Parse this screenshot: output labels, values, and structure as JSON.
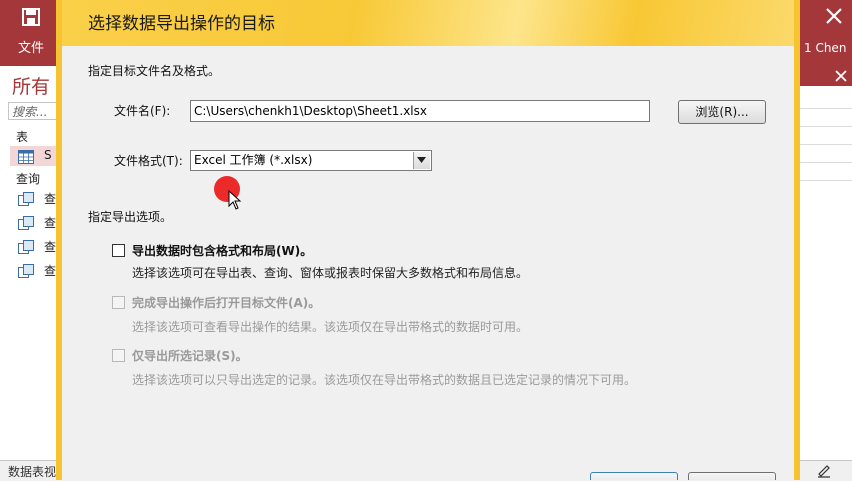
{
  "background": {
    "file_tab": "文件",
    "user_name": "1 Chen",
    "nav_title": "所有",
    "search_placeholder": "搜索...",
    "categories": {
      "tables": "表",
      "queries": "查询"
    },
    "nav_items": [
      {
        "label": "S",
        "icon": "table-icon",
        "selected": true
      },
      {
        "label": "查",
        "icon": "query-icon"
      },
      {
        "label": "查",
        "icon": "query-icon"
      },
      {
        "label": "查",
        "icon": "query-icon"
      },
      {
        "label": "查",
        "icon": "query-icon"
      }
    ],
    "status_text": "数据表视",
    "accent_color": "#a4373a"
  },
  "dialog": {
    "title": "选择数据导出操作的目标",
    "header_color": "#f8c937",
    "section_file": "指定目标文件名及格式。",
    "filename_label": "文件名(F):",
    "filename_value": "C:\\Users\\chenkh1\\Desktop\\Sheet1.xlsx",
    "browse_button": "浏览(R)...",
    "format_label": "文件格式(T):",
    "format_value": "Excel 工作簿 (*.xlsx)",
    "section_options": "指定导出选项。",
    "options": [
      {
        "label": "导出数据时包含格式和布局(W)。",
        "description": "选择该选项可在导出表、查询、窗体或报表时保留大多数格式和布局信息。",
        "checked": false,
        "enabled": true
      },
      {
        "label": "完成导出操作后打开目标文件(A)。",
        "description": "选择该选项可查看导出操作的结果。该选项仅在导出带格式的数据时可用。",
        "checked": false,
        "enabled": false
      },
      {
        "label": "仅导出所选记录(S)。",
        "description": "选择该选项可以只导出选定的记录。该选项仅在导出带格式的数据且已选定记录的情况下可用。",
        "checked": false,
        "enabled": false
      }
    ]
  }
}
